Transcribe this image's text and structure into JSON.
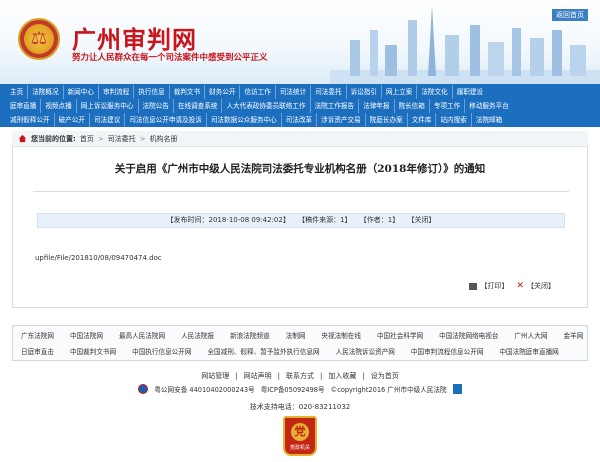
{
  "header": {
    "site_title": "广州审判网",
    "slogan": "努力让人民群众在每一个司法案件中感受到公平正义",
    "back_link": "返回首页"
  },
  "nav": {
    "row1": [
      "主页",
      "法院概况",
      "新闻中心",
      "审判流程",
      "执行信息",
      "裁判文书",
      "财务公开",
      "信访工作",
      "司法统计",
      "司法委托",
      "诉讼指引",
      "网上立案",
      "法院文化",
      "履职建设"
    ],
    "row2": [
      "庭审直播",
      "视频点播",
      "网上诉讼服务中心",
      "法院公告",
      "在线调查系统",
      "人大代表政协委员联络工作",
      "法院工作报告",
      "法律年报",
      "院长信箱",
      "专项工作",
      "移动服务平台"
    ],
    "row3": [
      "减刑假释公开",
      "破产公开",
      "司法建议",
      "司法信息公开申请及投诉",
      "司法数据公众服务中心",
      "司法改革",
      "涉诉资产交易",
      "院庭长办案",
      "文件库",
      "站内搜索",
      "法院邮箱"
    ]
  },
  "breadcrumb": {
    "label": "您当前的位置:",
    "items": [
      "首页",
      "司法委托",
      "机构名册"
    ]
  },
  "article": {
    "title": "关于启用《广州市中级人民法院司法委托专业机构名册（2018年修订）》的通知",
    "publish_time": "【发布时间：2018-10-08 09:42:02】",
    "source": "【稿件来源：1】",
    "author": "【作者：1】",
    "close_top": "【关闭】",
    "file_path": "upfile/File/201810/08/09470474.doc",
    "print": "【打印】",
    "close_bottom": "【关闭】"
  },
  "links": {
    "row1": [
      "广东法院网",
      "中国法院网",
      "最高人民法院网",
      "人民法院报",
      "新浪法院频道",
      "法制网",
      "央视法制在线",
      "中国社会科学网",
      "中国法院网络电视台",
      "广州人大网",
      "金羊网"
    ],
    "row2": [
      "日庭审直击",
      "中国裁判文书网",
      "中国执行信息公开网",
      "全国减刑、假释、暂予监外执行信息网",
      "人民法院诉讼资产网",
      "中国审判流程信息公开网",
      "中国法院庭审直播网"
    ]
  },
  "footer": {
    "line1": [
      "网站管理",
      "网站声明",
      "联系方式",
      "加入收藏",
      "设为首页"
    ],
    "police": "粤公网安备 44010402000243号",
    "icp": "粤ICP备05092498号",
    "copyright": "©copyright2016 广州市中级人民法院",
    "support": "技术支持电话：020-83211032",
    "badge_text": "党政机关"
  },
  "colors": {
    "brand_red": "#c8141b",
    "nav_blue": "#1c6fbf"
  }
}
